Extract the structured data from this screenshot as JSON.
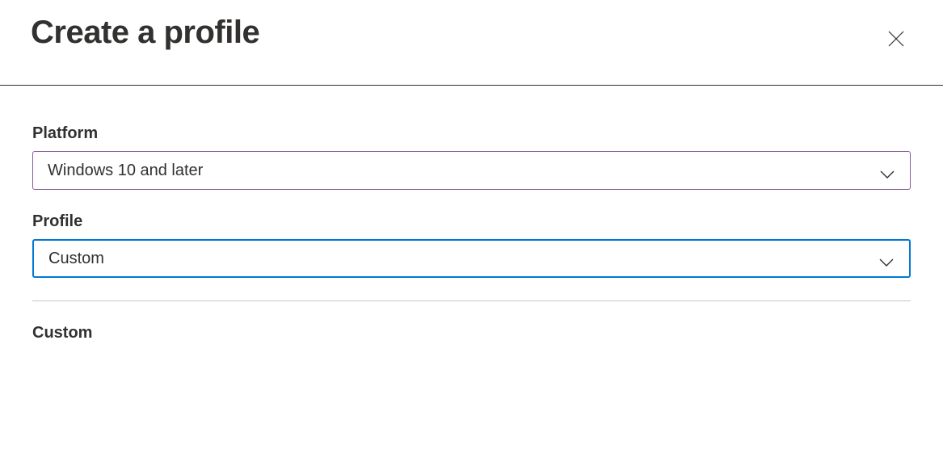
{
  "header": {
    "title": "Create a profile"
  },
  "fields": {
    "platform": {
      "label": "Platform",
      "value": "Windows 10 and later"
    },
    "profile": {
      "label": "Profile",
      "value": "Custom"
    }
  },
  "section": {
    "heading": "Custom"
  }
}
